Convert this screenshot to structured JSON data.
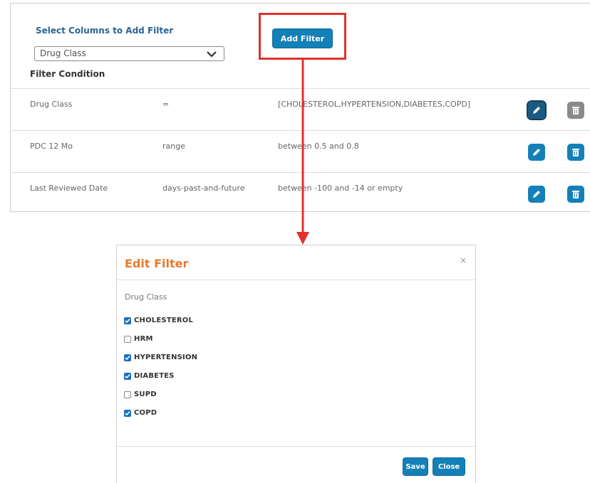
{
  "filter_panel": {
    "select_label": "Select Columns to Add Filter",
    "select_value": "Drug Class",
    "add_filter_label": "Add Filter",
    "filter_condition_heading": "Filter Condition",
    "rows": [
      {
        "column": "Drug Class",
        "operator": "=",
        "value": "[CHOLESTEROL,HYPERTENSION,DIABETES,COPD]"
      },
      {
        "column": "PDC 12 Mo",
        "operator": "range",
        "value": "between 0.5 and 0.8"
      },
      {
        "column": "Last Reviewed Date",
        "operator": "days-past-and-future",
        "value": "between -100 and -14 or empty"
      }
    ]
  },
  "edit_modal": {
    "title": "Edit Filter",
    "close_symbol": "×",
    "field_label": "Drug Class",
    "options": [
      {
        "label": "CHOLESTEROL",
        "checked": true
      },
      {
        "label": "HRM",
        "checked": false
      },
      {
        "label": "HYPERTENSION",
        "checked": true
      },
      {
        "label": "DIABETES",
        "checked": true
      },
      {
        "label": "SUPD",
        "checked": false
      },
      {
        "label": "COPD",
        "checked": true
      }
    ],
    "save_label": "Save",
    "close_label": "Close"
  },
  "icons": {
    "edit": "pencil-icon",
    "delete": "trash-icon",
    "dropdown": "chevron-down-icon",
    "checkbox_checked": "check-icon"
  },
  "colors": {
    "accent_blue": "#1480b8",
    "highlight_red": "#e0322c",
    "modal_title_orange": "#e87a2c",
    "disabled_gray": "#8a8a8a"
  }
}
